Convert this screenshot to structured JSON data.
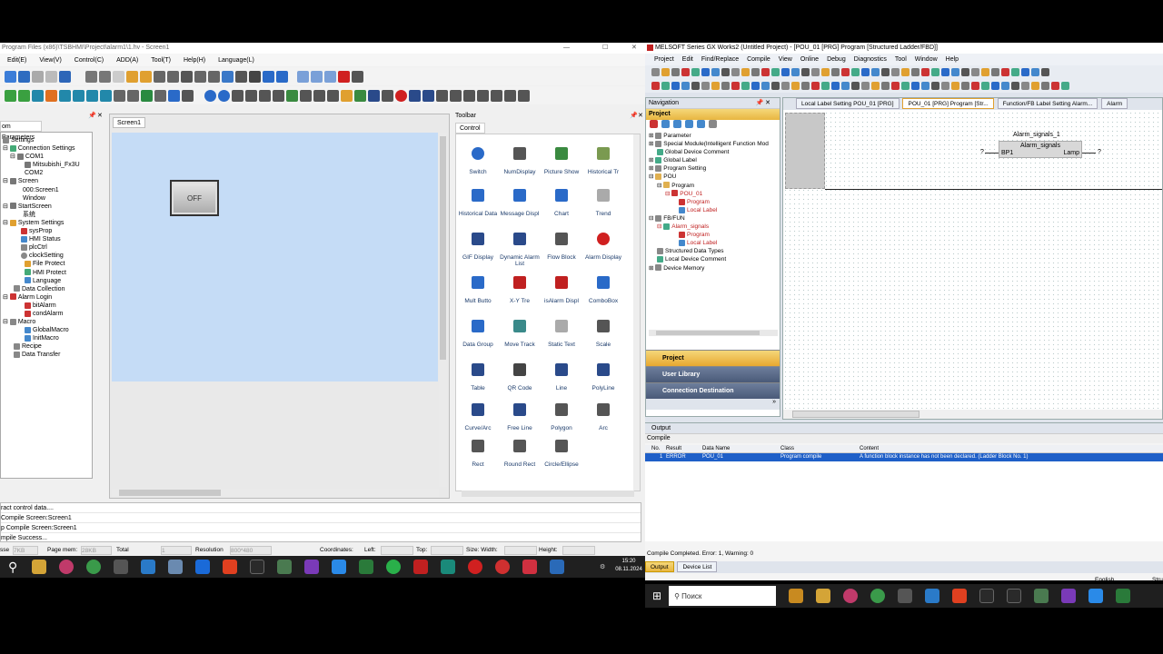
{
  "left": {
    "title": "Program Files (x86)\\TSBHMI\\Project\\alarm1\\1.hv - Screen1",
    "menu": [
      "Edit(E)",
      "View(V)",
      "Control(C)",
      "ADD(A)",
      "Tool(T)",
      "Help(H)",
      "Language(L)"
    ],
    "param_tab": "om Parameters",
    "canvas_tab": "Screen1",
    "off_label": "OFF",
    "toolbar_title": "Toolbar",
    "control_tab": "Control",
    "tree": [
      "Settings",
      "Connection Settings",
      "COM1",
      "Mitsubishi_Fx3U",
      "COM2",
      "Screen",
      "000:Screen1",
      "Window",
      "StartScreen",
      "系统",
      "System Settings",
      "sysProp",
      "HMI Status",
      "plcCtrl",
      "clockSetting",
      "File Protect",
      "HMI Protect",
      "Language",
      "Data Collection",
      "Alarm Login",
      "bitAlarm",
      "condAlarm",
      "Macro",
      "GlobalMacro",
      "InitMacro",
      "Recipe",
      "Data Transfer"
    ],
    "tools": [
      "Switch",
      "NumDisplay",
      "Picture Show",
      "Historical Tr",
      "Historical Data",
      "Message Displ",
      "Chart",
      "Trend",
      "GIF Display",
      "Dynamic Alarm List",
      "Flow Block",
      "Alarm Display",
      "Mult Butto",
      "X-Y Tre",
      "isAlarm Displ",
      "ComboBox",
      "Data Group",
      "Move Track",
      "Static Text",
      "Scale",
      "Table",
      "QR Code",
      "Line",
      "PolyLine",
      "Curve/Arc",
      "Free Line",
      "Polygon",
      "Arc",
      "Rect",
      "Round Rect",
      "Circle/Ellipse"
    ],
    "log": [
      "ract control data....",
      "Compile Screen:Screen1",
      "p Compile Screen:Screen1",
      "mpile Success..."
    ],
    "status": {
      "size": "sse",
      "size_val": "7KB",
      "pagemem": "Page mem:",
      "pagemem_val": "28KB",
      "total": "Total",
      "total_val": "1",
      "res": "Resolution",
      "res_val": "800*480",
      "coords": "Coordinates:",
      "leftl": "Left:",
      "top": "Top:",
      "sizew": "Size: Width:",
      "height": "Height:"
    },
    "time": "15:20",
    "date": "08.11.2024"
  },
  "right": {
    "title": "MELSOFT Series GX Works2 (Untitled Project) - [POU_01 [PRG] Program [Structured Ladder/FBD]]",
    "menu": [
      "Project",
      "Edit",
      "Find/Replace",
      "Compile",
      "View",
      "Online",
      "Debug",
      "Diagnostics",
      "Tool",
      "Window",
      "Help"
    ],
    "nav_title": "Navigation",
    "nav_sub": "Project",
    "tree": [
      "Parameter",
      "Special Module(Intelligent Function Mod",
      "Global Device Comment",
      "Global Label",
      "Program Setting",
      "POU",
      "Program",
      "POU_01",
      "Program",
      "Local Label",
      "FB/FUN",
      "Alarm_signals",
      "Program",
      "Local Label",
      "Structured Data Types",
      "Local Device Comment",
      "Device Memory"
    ],
    "nav_buttons": [
      "Project",
      "User Library",
      "Connection Destination"
    ],
    "tabs": [
      "Local Label Setting POU_01 [PRG]",
      "POU_01 [PRG] Program [Str...",
      "Function/FB Label Setting Alarm...",
      "Alarm"
    ],
    "fb": {
      "instance": "Alarm_signals_1",
      "name": "Alarm_signals",
      "in": "BP1",
      "out": "Lamp",
      "q": "?"
    },
    "output_title": "Output",
    "compile_label": "Compile",
    "table_head": [
      "No.",
      "Result",
      "Data Name",
      "Class",
      "Content"
    ],
    "table_row": [
      "1",
      "ERROR",
      "POU_01",
      "Program compile",
      "A function block instance has not been declared. (Ladder Block No. 1)"
    ],
    "compile_status": "Compile Completed. Error: 1, Warning: 0",
    "bottom_tabs": [
      "Output",
      "Device List"
    ],
    "lang": "English",
    "lang2": "Stru",
    "search": "Поиск"
  }
}
